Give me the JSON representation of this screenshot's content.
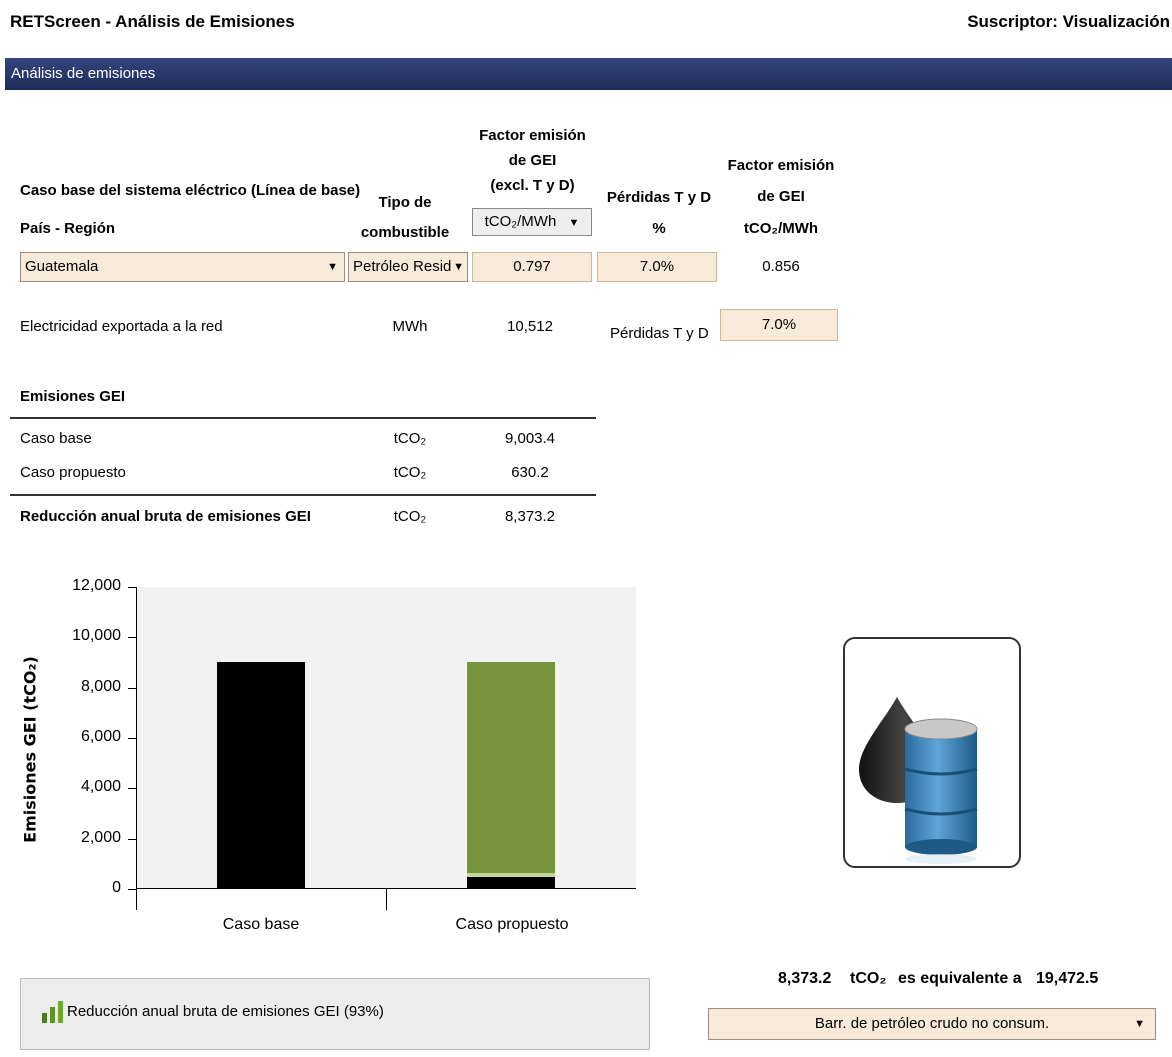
{
  "header": {
    "app_title": "RETScreen - Análisis de Emisiones",
    "subscriber": "Suscriptor: Visualización"
  },
  "section": {
    "title": "Análisis de emisiones"
  },
  "table": {
    "caso_base_label": "Caso base del sistema eléctrico (Línea de base)",
    "pais_region_label": "País - Región",
    "tipo_comb_line1": "Tipo de",
    "tipo_comb_line2": "combustible",
    "factor_excl_line1": "Factor emisión",
    "factor_excl_line2": "de GEI",
    "factor_excl_line3": "(excl. T y D)",
    "factor_excl_unit": "tCO₂/MWh",
    "perdidas_line1": "Pérdidas T y D",
    "perdidas_line2": "%",
    "factor_line1": "Factor emisión",
    "factor_line2": "de GEI",
    "factor_line3": "tCO₂/MWh",
    "country": "Guatemala",
    "fuel": "Petróleo Residu",
    "factor_excl_value": "0.797",
    "perdidas_value": "7.0%",
    "factor_value": "0.856"
  },
  "export": {
    "label": "Electricidad exportada a la red",
    "unit": "MWh",
    "value": "10,512",
    "losses_label": "Pérdidas T y D",
    "losses_value": "7.0%"
  },
  "emissions": {
    "title": "Emisiones GEI",
    "rows": [
      {
        "label": "Caso base",
        "unit": "tCO₂",
        "value": "9,003.4"
      },
      {
        "label": "Caso propuesto",
        "unit": "tCO₂",
        "value": "630.2"
      }
    ],
    "total_label": "Reducción anual bruta de emisiones GEI",
    "total_unit": "tCO₂",
    "total_value": "8,373.2"
  },
  "chart_data": {
    "type": "bar",
    "ylabel": "Emisiones GEI (tCO₂)",
    "categories": [
      "Caso base",
      "Caso propuesto"
    ],
    "ylim": [
      0,
      12000
    ],
    "yticks": [
      "0",
      "2,000",
      "4,000",
      "6,000",
      "8,000",
      "10,000",
      "12,000"
    ],
    "ytick_values": [
      0,
      2000,
      4000,
      6000,
      8000,
      10000,
      12000
    ],
    "series": [
      {
        "values": [
          9003.4,
          630.2
        ],
        "color": "#000000"
      },
      {
        "values": [
          0,
          8373.2
        ],
        "color": "#77933c"
      }
    ],
    "reduction_band_color": "#c4d79b"
  },
  "legend": {
    "label": "Reducción anual bruta de emisiones GEI (93%)"
  },
  "equivalence": {
    "value": "8,373.2",
    "unit": "tCO₂",
    "text": "es equivalente a",
    "result": "19,472.5",
    "option": "Barr. de petróleo crudo no consum."
  },
  "colors": {
    "header_bar": "#2b3a6b",
    "input_bg": "#f7ead9",
    "dark_bar": "#000000",
    "green_bar": "#77933c"
  }
}
